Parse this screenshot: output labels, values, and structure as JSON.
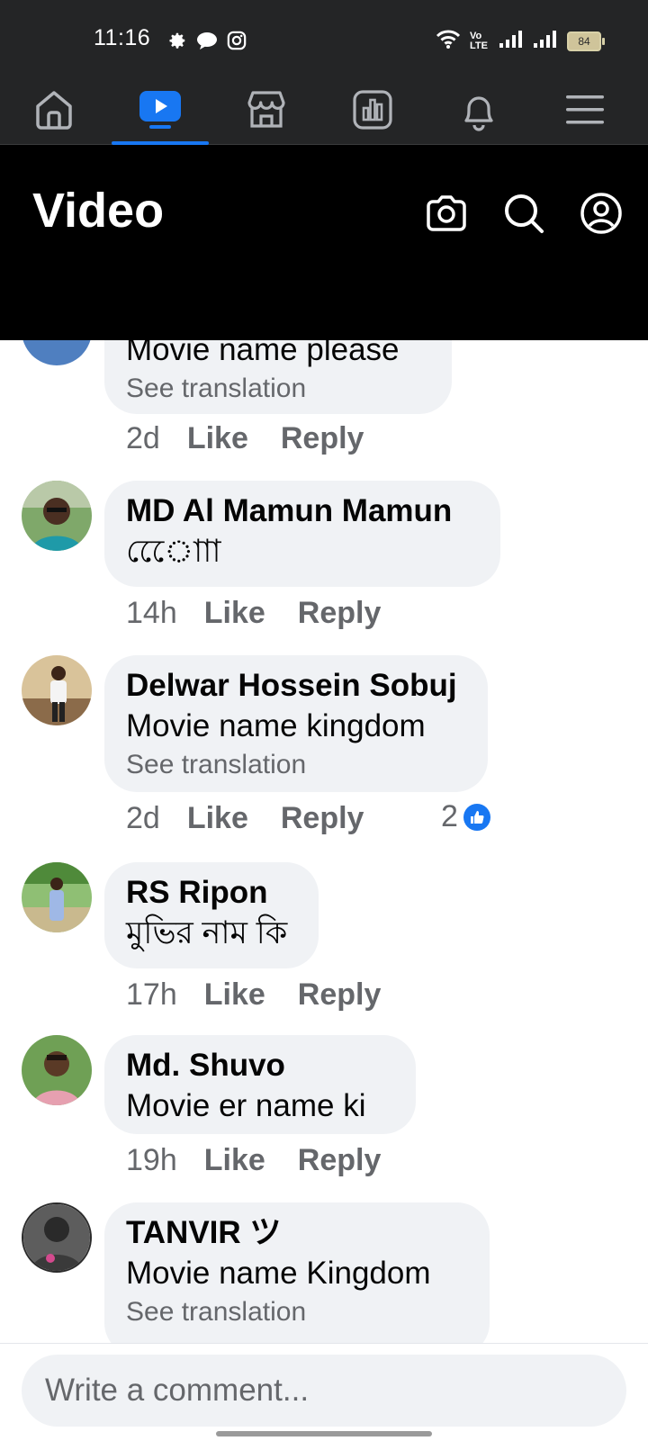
{
  "status_bar": {
    "time": "11:16",
    "battery": "84",
    "network_label": "Vo LTE"
  },
  "nav": {
    "items": [
      {
        "name": "home",
        "icon": "home-icon"
      },
      {
        "name": "video",
        "icon": "video-icon",
        "active": true
      },
      {
        "name": "marketplace",
        "icon": "store-icon"
      },
      {
        "name": "feeds",
        "icon": "feeds-icon"
      },
      {
        "name": "notifications",
        "icon": "bell-icon"
      },
      {
        "name": "menu",
        "icon": "menu-icon"
      }
    ],
    "accent": "#1877f2"
  },
  "header": {
    "title": "Video"
  },
  "comments": [
    {
      "author": "",
      "text": "Movie name please",
      "translation": "See translation",
      "time": "2d",
      "like": "Like",
      "reply": "Reply"
    },
    {
      "author": "MD Al Mamun Mamun",
      "text": "েেোাা",
      "time": "14h",
      "like": "Like",
      "reply": "Reply"
    },
    {
      "author": "Delwar Hossein Sobuj",
      "text": "Movie name kingdom",
      "translation": "See translation",
      "time": "2d",
      "like": "Like",
      "reply": "Reply",
      "reaction_count": "2"
    },
    {
      "author": "RS Ripon",
      "text": "মুভির নাম কি",
      "time": "17h",
      "like": "Like",
      "reply": "Reply"
    },
    {
      "author": "Md. Shuvo",
      "text": "Movie er name ki",
      "time": "19h",
      "like": "Like",
      "reply": "Reply"
    },
    {
      "author": "TANVIR ツ",
      "text": "Movie name Kingdom",
      "translation": "See translation"
    }
  ],
  "composer": {
    "placeholder": "Write a comment..."
  }
}
